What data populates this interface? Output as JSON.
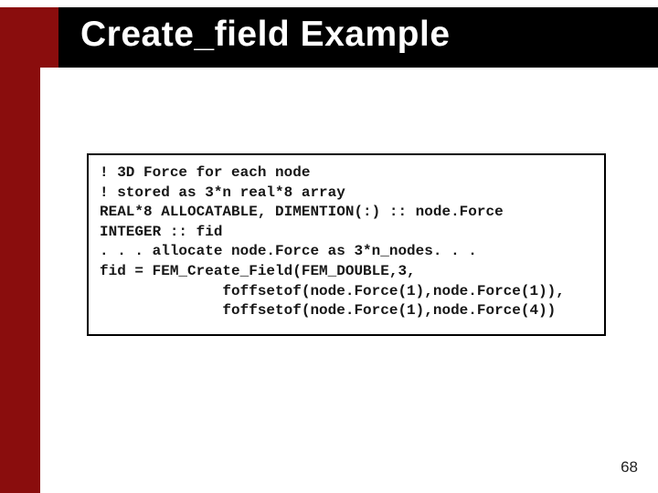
{
  "title": "Create_field Example",
  "code": {
    "l1": "! 3D Force for each node",
    "l2": "! stored as 3*n real*8 array",
    "l3": "",
    "l4": "REAL*8 ALLOCATABLE, DIMENTION(:) :: node.Force",
    "l5": "INTEGER :: fid",
    "l6": "",
    "l7": ". . . allocate node.Force as 3*n_nodes. . .",
    "l8": "",
    "l9": "fid = FEM_Create_Field(FEM_DOUBLE,3,",
    "l10": "              foffsetof(node.Force(1),node.Force(1)),",
    "l11": "              foffsetof(node.Force(1),node.Force(4))"
  },
  "page_number": "68"
}
